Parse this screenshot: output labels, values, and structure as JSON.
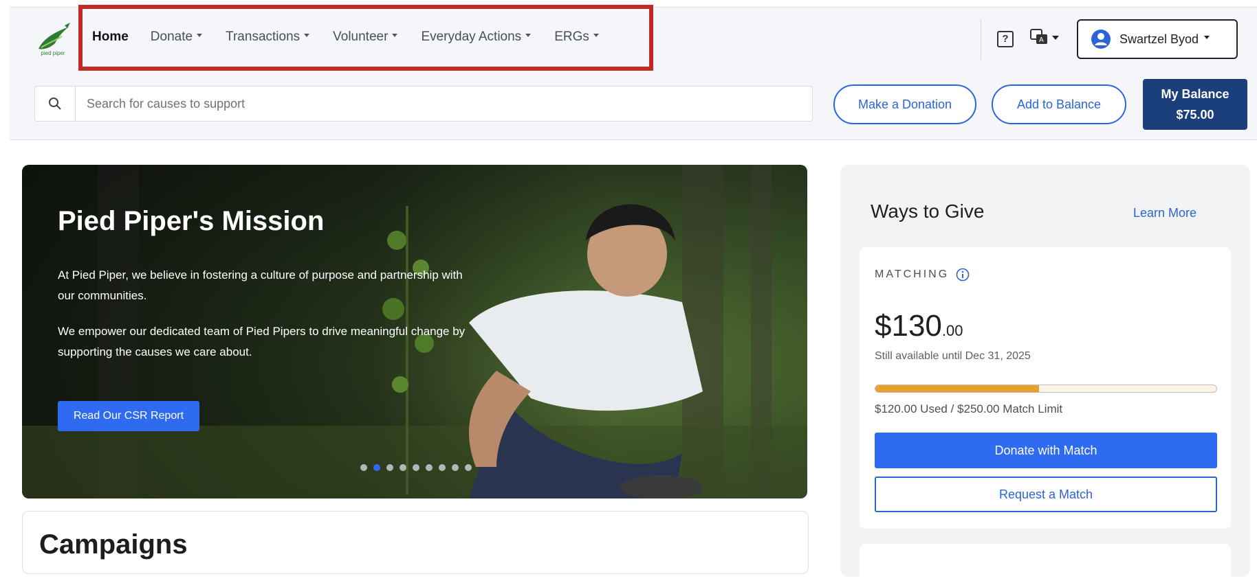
{
  "brand": {
    "logo_text": "pied piper"
  },
  "nav": {
    "items": [
      {
        "label": "Home",
        "dropdown": false
      },
      {
        "label": "Donate",
        "dropdown": true
      },
      {
        "label": "Transactions",
        "dropdown": true
      },
      {
        "label": "Volunteer",
        "dropdown": true
      },
      {
        "label": "Everyday Actions",
        "dropdown": true
      },
      {
        "label": "ERGs",
        "dropdown": true
      }
    ],
    "highlight_color": "#c22b25"
  },
  "header": {
    "help_icon": "question-icon",
    "help_glyph": "?",
    "translate_icon": "translate-icon",
    "user_name": "Swartzel Byod"
  },
  "search": {
    "placeholder": "Search for causes to support",
    "value": ""
  },
  "actions": {
    "make_donation": "Make a Donation",
    "add_balance": "Add to Balance",
    "balance_label": "My Balance",
    "balance_value": "$75.00"
  },
  "hero": {
    "title": "Pied Piper's Mission",
    "paragraph1": "At Pied Piper, we believe in fostering a culture of purpose and partnership with our communities.",
    "paragraph2": "We empower our dedicated team of Pied Pipers to drive meaningful change by supporting the causes we care about.",
    "button": "Read Our CSR Report",
    "slide_count": 9,
    "active_slide": 1
  },
  "campaigns": {
    "title": "Campaigns"
  },
  "ways_to_give": {
    "title": "Ways to Give",
    "learn_more": "Learn More",
    "matching": {
      "label": "MATCHING",
      "amount_whole": "$130",
      "amount_cents": ".00",
      "availability": "Still available until Dec 31, 2025",
      "used_fraction": 0.48,
      "usage_text": "$120.00 Used / $250.00 Match Limit",
      "donate_button": "Donate with Match",
      "request_button": "Request a Match"
    }
  },
  "colors": {
    "accent": "#2f6bf0",
    "dark_navy": "#1b3f7a",
    "progress": "#e8a12c"
  }
}
